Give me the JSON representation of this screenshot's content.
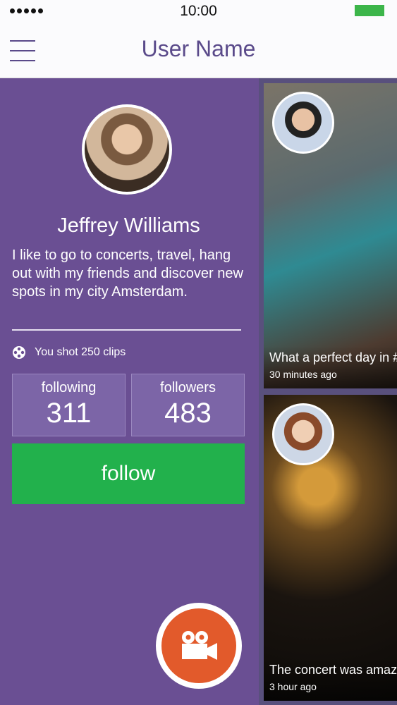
{
  "status": {
    "time": "10:00"
  },
  "nav": {
    "title": "User Name"
  },
  "profile": {
    "name": "Jeffrey Williams",
    "bio": "I like to go to concerts, travel, hang out with my friends and discover new spots in my city Amsterdam.",
    "clips_text": "You shot 250 clips",
    "following_label": "following",
    "following_value": "311",
    "followers_label": "followers",
    "followers_value": "483",
    "follow_label": "follow"
  },
  "feed": [
    {
      "title": "What a perfect day in #",
      "ago": "30 minutes ago"
    },
    {
      "title": "The concert was amazi",
      "ago": "3 hour ago"
    }
  ],
  "colors": {
    "panel": "#6a4f93",
    "accent": "#5a4a8a",
    "follow": "#22b14c",
    "fab": "#e25a2b"
  },
  "icons": {
    "menu": "hamburger-icon",
    "clips": "film-reel-icon",
    "camera": "video-camera-icon"
  }
}
